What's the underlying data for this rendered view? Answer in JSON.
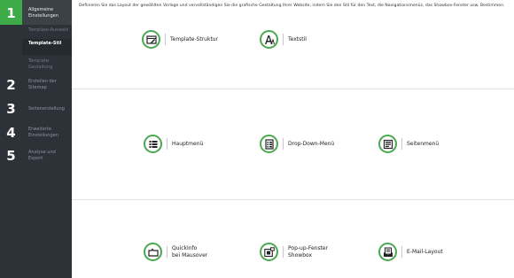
{
  "sidebar": {
    "steps": [
      {
        "number": "1",
        "title": "Allgemeine Einstellungen"
      },
      {
        "number": "2",
        "title": "Erstellen der Sitemap"
      },
      {
        "number": "3",
        "title": "Seitenerstellung"
      },
      {
        "number": "4",
        "title": "Erweiterte Einstellungen"
      },
      {
        "number": "5",
        "title": "Analyse und Export"
      }
    ],
    "substeps": [
      {
        "label": "Template-Auswahl"
      },
      {
        "label": "Template-Stil"
      },
      {
        "label": "Template-Gestaltung"
      }
    ]
  },
  "main": {
    "description": "Definieren Sie das Layout der gewählten Vorlage und vervollständigen Sie die grafische Gestaltung Ihrer Website, indem Sie den Stil für den Text, die Navigationsmenüs, das Showbox-Fenster usw. Bestimmen.",
    "options": [
      {
        "label": "Template-Struktur",
        "icon": "template-structure-icon"
      },
      {
        "label": "Textstil",
        "icon": "text-style-icon"
      },
      {
        "label": "Hauptmenü",
        "icon": "list-menu-icon"
      },
      {
        "label": "Drop-Down-Menü",
        "icon": "dropdown-list-icon"
      },
      {
        "label": "Seitenmenü",
        "icon": "side-menu-icon"
      },
      {
        "label": "QuickInfo\nbei Mausover",
        "icon": "tooltip-icon"
      },
      {
        "label": "Pop-up-Fenster\nShowbox",
        "icon": "popup-window-icon"
      },
      {
        "label": "E-Mail-Layout",
        "icon": "email-layout-icon"
      }
    ]
  },
  "colors": {
    "accent": "#3dab48",
    "sidebar": "#2c3238",
    "icon_ring": "#4aa84e"
  }
}
